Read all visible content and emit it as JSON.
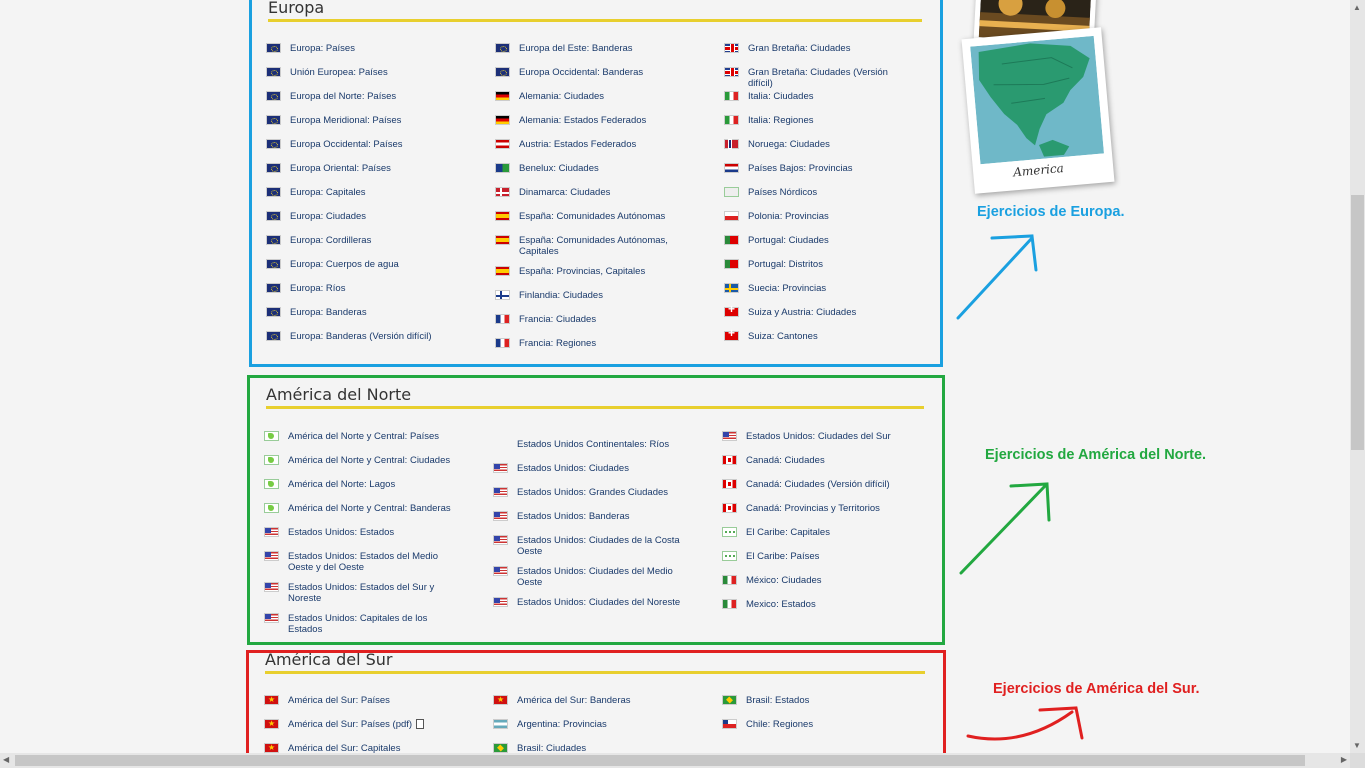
{
  "europa": {
    "title": "Europa",
    "columns": [
      [
        {
          "label": "Europa: Países",
          "flag": "eu"
        },
        {
          "label": "Unión Europea: Países",
          "flag": "eu"
        },
        {
          "label": "Europa del Norte: Países",
          "flag": "eu"
        },
        {
          "label": "Europa Meridional: Países",
          "flag": "eu"
        },
        {
          "label": "Europa Occidental: Países",
          "flag": "eu"
        },
        {
          "label": "Europa Oriental: Países",
          "flag": "eu"
        },
        {
          "label": "Europa: Capitales",
          "flag": "eu"
        },
        {
          "label": "Europa: Ciudades",
          "flag": "eu"
        },
        {
          "label": "Europa: Cordilleras",
          "flag": "eu"
        },
        {
          "label": "Europa: Cuerpos de agua",
          "flag": "eu"
        },
        {
          "label": "Europa: Ríos",
          "flag": "eu"
        },
        {
          "label": "Europa: Banderas",
          "flag": "eu"
        },
        {
          "label": "Europa: Banderas (Versión difícil)",
          "flag": "eu"
        }
      ],
      [
        {
          "label": "Europa del Este: Banderas",
          "flag": "eu"
        },
        {
          "label": "Europa Occidental: Banderas",
          "flag": "eu"
        },
        {
          "label": "Alemania: Ciudades",
          "flag": "de"
        },
        {
          "label": "Alemania: Estados Federados",
          "flag": "de"
        },
        {
          "label": "Austria: Estados Federados",
          "flag": "at"
        },
        {
          "label": "Benelux: Ciudades",
          "flag": "be"
        },
        {
          "label": "Dinamarca: Ciudades",
          "flag": "dk"
        },
        {
          "label": "España: Comunidades Autónomas",
          "flag": "es"
        },
        {
          "label": "España: Comunidades Autónomas, Capitales",
          "flag": "es"
        },
        {
          "label": "España: Provincias, Capitales",
          "flag": "es"
        },
        {
          "label": "Finlandia: Ciudades",
          "flag": "fi"
        },
        {
          "label": "Francia: Ciudades",
          "flag": "fr"
        },
        {
          "label": "Francia: Regiones",
          "flag": "fr"
        }
      ],
      [
        {
          "label": "Gran Bretaña: Ciudades",
          "flag": "gb"
        },
        {
          "label": "Gran Bretaña: Ciudades (Versión difícil)",
          "flag": "gb"
        },
        {
          "label": "Italia: Ciudades",
          "flag": "it"
        },
        {
          "label": "Italia: Regiones",
          "flag": "it"
        },
        {
          "label": "Noruega: Ciudades",
          "flag": "no"
        },
        {
          "label": "Países Bajos: Provincias",
          "flag": "nl"
        },
        {
          "label": "Países Nórdicos",
          "flag": "nord"
        },
        {
          "label": "Polonia: Provincias",
          "flag": "pl"
        },
        {
          "label": "Portugal: Ciudades",
          "flag": "pt"
        },
        {
          "label": "Portugal: Distritos",
          "flag": "pt"
        },
        {
          "label": "Suecia: Provincias",
          "flag": "se"
        },
        {
          "label": "Suiza y Austria: Ciudades",
          "flag": "ch"
        },
        {
          "label": "Suiza: Cantones",
          "flag": "ch"
        }
      ]
    ]
  },
  "norte": {
    "title": "América del Norte",
    "columns": [
      [
        {
          "label": "América del Norte y Central: Países",
          "flag": "map"
        },
        {
          "label": "América del Norte y Central: Ciudades",
          "flag": "map"
        },
        {
          "label": "América del Norte: Lagos",
          "flag": "map"
        },
        {
          "label": "América del Norte y Central: Banderas",
          "flag": "map"
        },
        {
          "label": "Estados Unidos: Estados",
          "flag": "us"
        },
        {
          "label": "Estados Unidos: Estados del Medio Oeste y del Oeste",
          "flag": "us"
        },
        {
          "label": "Estados Unidos: Estados del Sur y Noreste",
          "flag": "us"
        },
        {
          "label": "Estados Unidos: Capitales de los Estados",
          "flag": "us"
        }
      ],
      [
        {
          "label": "Estados Unidos Continentales: Ríos",
          "flag": "none"
        },
        {
          "label": "Estados Unidos: Ciudades",
          "flag": "us"
        },
        {
          "label": "Estados Unidos: Grandes Ciudades",
          "flag": "us"
        },
        {
          "label": "Estados Unidos: Banderas",
          "flag": "us"
        },
        {
          "label": "Estados Unidos: Ciudades de la Costa Oeste",
          "flag": "us"
        },
        {
          "label": "Estados Unidos: Ciudades del Medio Oeste",
          "flag": "us"
        },
        {
          "label": "Estados Unidos: Ciudades del Noreste",
          "flag": "us"
        }
      ],
      [
        {
          "label": "Estados Unidos: Ciudades del Sur",
          "flag": "us"
        },
        {
          "label": "Canadá: Ciudades",
          "flag": "ca"
        },
        {
          "label": "Canadá: Ciudades (Versión difícil)",
          "flag": "ca"
        },
        {
          "label": "Canadá: Provincias y Territorios",
          "flag": "ca"
        },
        {
          "label": "El Caribe: Capitales",
          "flag": "car"
        },
        {
          "label": "El Caribe: Países",
          "flag": "car"
        },
        {
          "label": "México: Ciudades",
          "flag": "mx"
        },
        {
          "label": "Mexico: Estados",
          "flag": "mx"
        }
      ]
    ]
  },
  "sur": {
    "title": "América del Sur",
    "columns": [
      [
        {
          "label": "América del Sur: Países",
          "flag": "sa"
        },
        {
          "label": "América del Sur: Países (pdf)",
          "flag": "sa",
          "file": true
        },
        {
          "label": "América del Sur: Capitales",
          "flag": "sa"
        }
      ],
      [
        {
          "label": "América del Sur: Banderas",
          "flag": "sa"
        },
        {
          "label": "Argentina: Provincias",
          "flag": "ar"
        },
        {
          "label": "Brasil: Ciudades",
          "flag": "br"
        }
      ],
      [
        {
          "label": "Brasil: Estados",
          "flag": "br"
        },
        {
          "label": "Chile: Regiones",
          "flag": "cl"
        }
      ]
    ]
  },
  "annotations": {
    "europa": "Ejercicios de Europa.",
    "norte": "Ejercicios de América del Norte.",
    "sur": "Ejercicios de América del Sur."
  },
  "photo_caption": "America",
  "colors": {
    "europa_border": "#1aa0e0",
    "norte_border": "#22a840",
    "sur_border": "#e02020",
    "title_rule": "#e8cf2e",
    "link_text": "#1a3a6b"
  }
}
